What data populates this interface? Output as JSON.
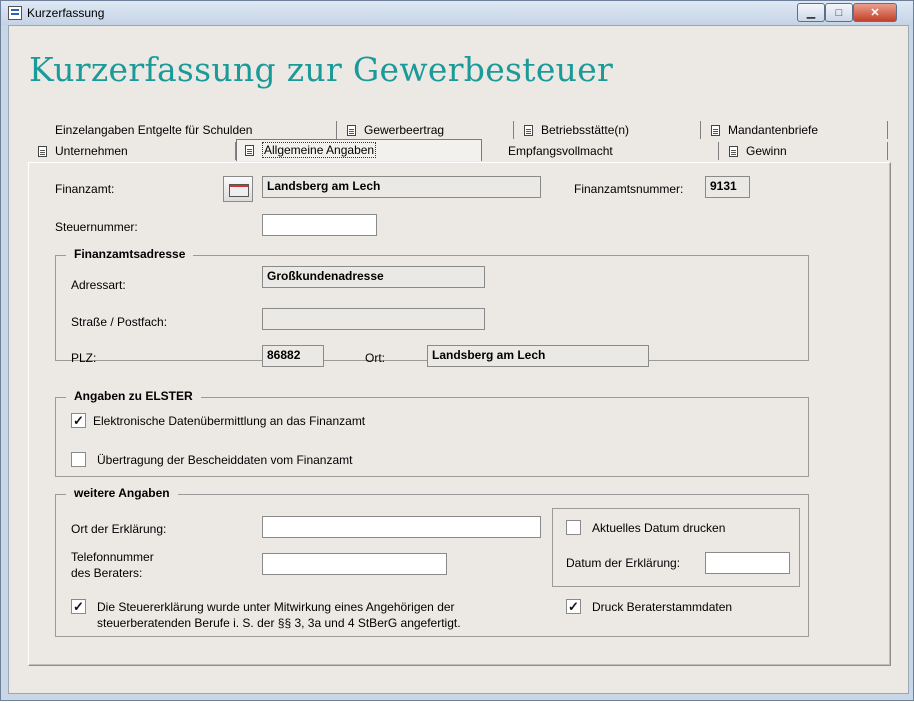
{
  "window": {
    "title": "Kurzerfassung"
  },
  "heading": "Kurzerfassung zur Gewerbesteuer",
  "tabs_row1": [
    {
      "label": "Einzelangaben Entgelte für Schulden",
      "icon": false
    },
    {
      "label": "Gewerbeertrag",
      "icon": true
    },
    {
      "label": "Betriebsstätte(n)",
      "icon": true
    },
    {
      "label": "Mandantenbriefe",
      "icon": true
    }
  ],
  "tabs_row2": [
    {
      "label": "Unternehmen",
      "icon": true
    },
    {
      "label": "Allgemeine Angaben",
      "icon": true,
      "active": true
    },
    {
      "label": "Empfangsvollmacht",
      "icon": false
    },
    {
      "label": "Gewinn",
      "icon": true
    }
  ],
  "form": {
    "finanzamt_label": "Finanzamt:",
    "finanzamt_value": "Landsberg am Lech",
    "finanzamtsnummer_label": "Finanzamtsnummer:",
    "finanzamtsnummer_value": "9131",
    "steuernummer_label": "Steuernummer:",
    "steuernummer_value": ""
  },
  "address": {
    "title": "Finanzamtsadresse",
    "adressart_label": "Adressart:",
    "adressart_value": "Großkundenadresse",
    "strasse_label": "Straße / Postfach:",
    "strasse_value": "",
    "plz_label": "PLZ:",
    "plz_value": "86882",
    "ort_label": "Ort:",
    "ort_value": "Landsberg am Lech"
  },
  "elster": {
    "title": "Angaben zu ELSTER",
    "opt1_label": "Elektronische Datenübermittlung an das Finanzamt",
    "opt1_checked": true,
    "opt2_label": "Übertragung der Bescheiddaten vom Finanzamt",
    "opt2_checked": false
  },
  "weitere": {
    "title": "weitere Angaben",
    "ort_label": "Ort der Erklärung:",
    "ort_value": "",
    "telefon_label_1": "Telefonnummer",
    "telefon_label_2": "des Beraters:",
    "telefon_value": "",
    "datum_drucken_label": "Aktuelles Datum drucken",
    "datum_drucken_checked": false,
    "datum_label": "Datum der Erklärung:",
    "datum_value": "",
    "mitwirkung_label_1": "Die Steuererklärung wurde unter Mitwirkung eines Angehörigen der",
    "mitwirkung_label_2": "steuerberatenden Berufe i. S. der §§ 3, 3a und 4 StBerG angefertigt.",
    "mitwirkung_checked": true,
    "druck_berater_label": "Druck Beraterstammdaten",
    "druck_berater_checked": true
  }
}
